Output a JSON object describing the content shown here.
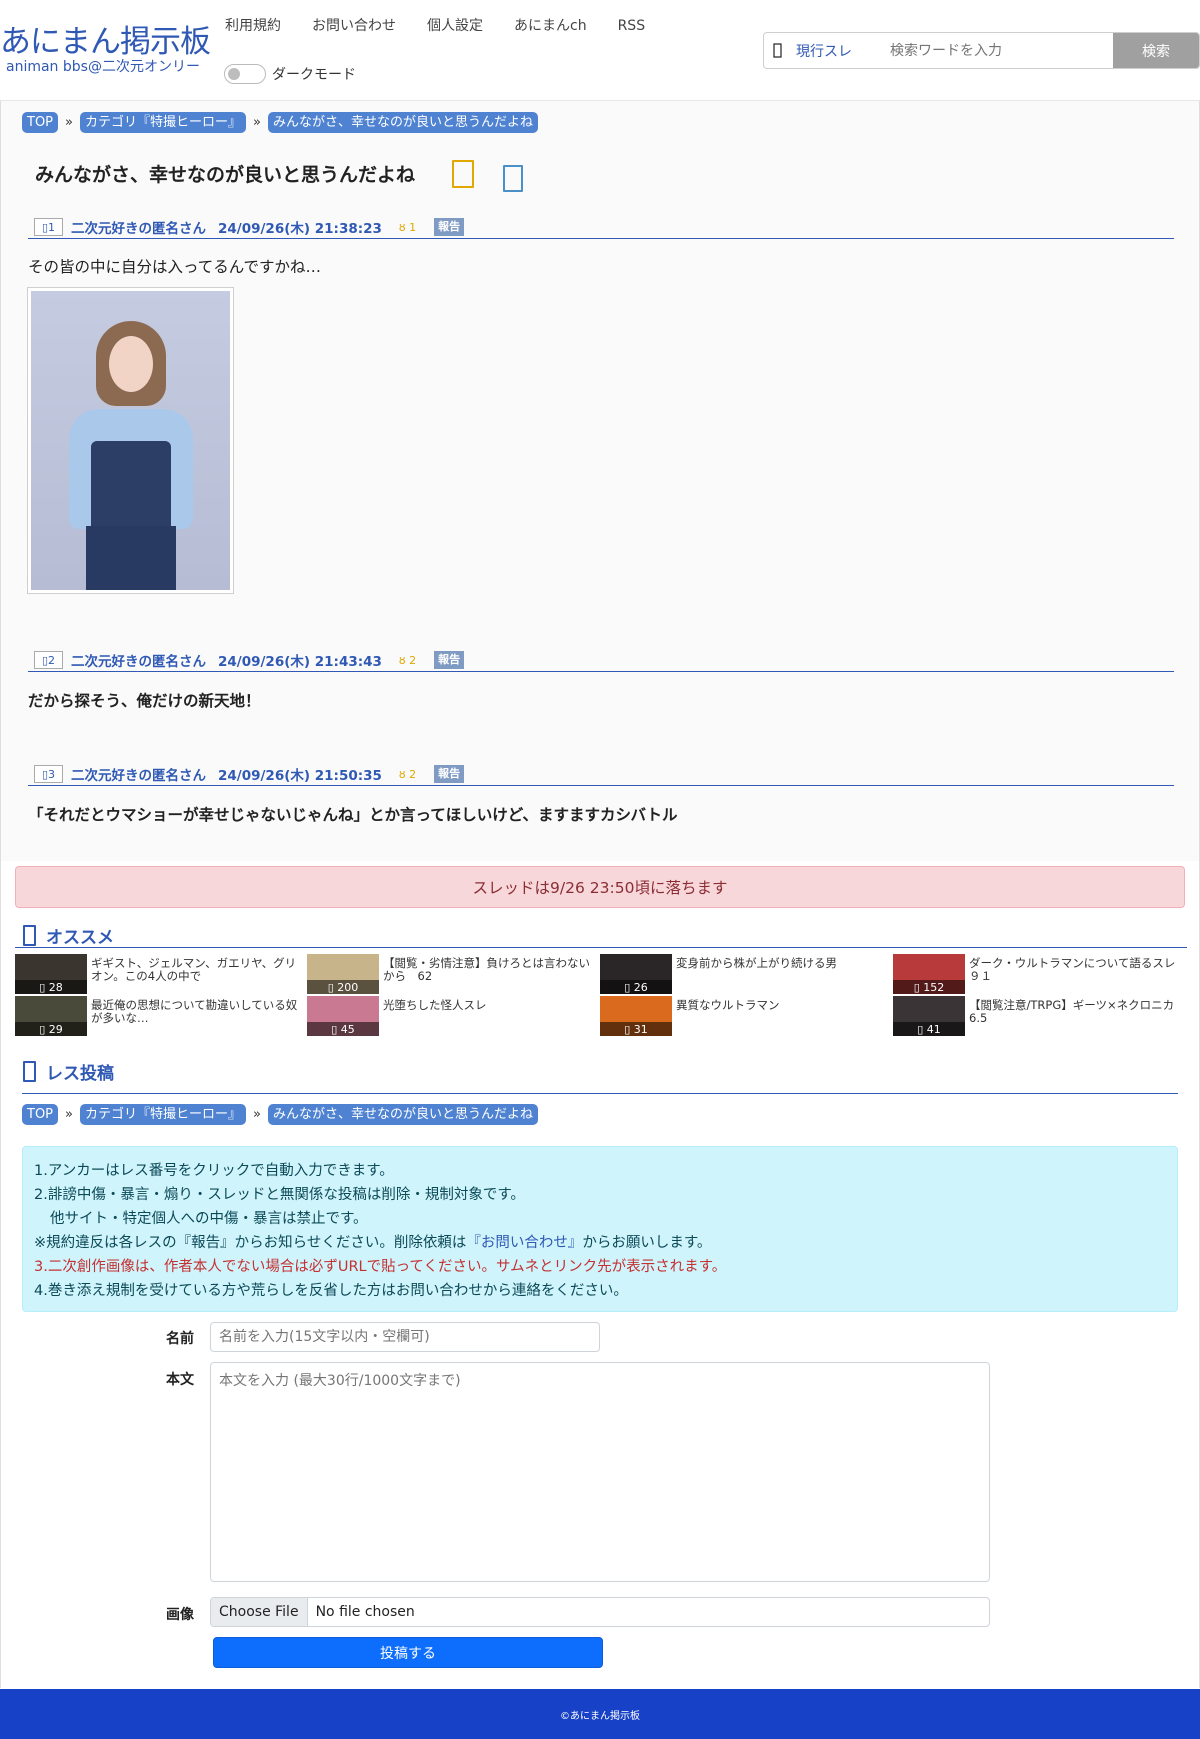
{
  "header": {
    "logo_main": "あにまん掲示板",
    "logo_sub": "animan bbs@二次元オンリー",
    "nav": [
      "利用規約",
      "お問い合わせ",
      "個人設定",
      "あにまんch",
      "RSS"
    ],
    "dark_mode_label": "ダークモード",
    "search": {
      "scope": "現行スレ",
      "placeholder": "検索ワードを入力",
      "button": "検索"
    }
  },
  "breadcrumb": {
    "top": "TOP",
    "category": "カテゴリ『特撮ヒーロー』",
    "thread": "みんながさ、幸せなのが良いと思うんだよね",
    "sep": "»"
  },
  "thread": {
    "title": "みんながさ、幸せなのが良いと思うんだよね",
    "posts": [
      {
        "num": "1",
        "name": "二次元好きの匿名さん",
        "date": "24/09/26(木) 21:38:23",
        "good": "1",
        "report": "報告",
        "body": "その皆の中に自分は入ってるんですかね…"
      },
      {
        "num": "2",
        "name": "二次元好きの匿名さん",
        "date": "24/09/26(木) 21:43:43",
        "good": "2",
        "report": "報告",
        "body": "だから探そう、俺だけの新天地！"
      },
      {
        "num": "3",
        "name": "二次元好きの匿名さん",
        "date": "24/09/26(木) 21:50:35",
        "good": "2",
        "report": "報告",
        "body": "「それだとウマショーが幸せじゃないじゃんね」とか言ってほしいけど、ますますカシバトル"
      }
    ]
  },
  "notice": "スレッドは9/26 23:50頃に落ちます",
  "recommend": {
    "title": "オススメ",
    "items": [
      {
        "count": "28",
        "text": "ギギスト、ジェルマン、ガエリヤ、グリオン。この4人の中で",
        "color": "#3b3530"
      },
      {
        "count": "200",
        "text": "【閲覧・劣情注意】負けろとは言わないから　62",
        "color": "#c8b48a"
      },
      {
        "count": "26",
        "text": "変身前から株が上がり続ける男",
        "color": "#2a2628"
      },
      {
        "count": "152",
        "text": "ダーク・ウルトラマンについて語るスレ　９１",
        "color": "#b83a3a"
      },
      {
        "count": "29",
        "text": "最近俺の思想について勘違いしている奴が多いな…",
        "color": "#4a4a3a"
      },
      {
        "count": "45",
        "text": "光堕ちした怪人スレ",
        "color": "#c97a92"
      },
      {
        "count": "31",
        "text": "異質なウルトラマン",
        "color": "#d96a1e"
      },
      {
        "count": "41",
        "text": "【閲覧注意/TRPG】ギーツ×ネクロニカ6.5",
        "color": "#3a3436"
      }
    ]
  },
  "reply": {
    "title": "レス投稿",
    "rules": {
      "r1": "1.アンカーはレス番号をクリックで自動入力できます。",
      "r2": "2.誹謗中傷・暴言・煽り・スレッドと無関係な投稿は削除・規制対象です。",
      "r2b": "他サイト・特定個人への中傷・暴言は禁止です。",
      "r_note_a": "※規約違反は各レスの『報告』からお知らせください。削除依頼は",
      "r_note_link": "『お問い合わせ』",
      "r_note_b": "からお願いします。",
      "r3": "3.二次創作画像は、作者本人でない場合は必ずURLで貼ってください。サムネとリンク先が表示されます。",
      "r4": "4.巻き添え規制を受けている方や荒らしを反省した方はお問い合わせから連絡をください。"
    },
    "name_label": "名前",
    "name_placeholder": "名前を入力(15文字以内・空欄可)",
    "body_label": "本文",
    "body_placeholder": "本文を入力 (最大30行/1000文字まで)",
    "image_label": "画像",
    "file_button": "Choose File",
    "file_status": "No file chosen",
    "submit": "投稿する"
  },
  "footer": "©あにまん掲示板",
  "colors": {
    "brand": "#2f59b4",
    "crumb": "#4f83d2",
    "notice_bg": "#f8d7da",
    "info_bg": "#cff4fc",
    "submit": "#0d6efd",
    "footer": "#1741c6"
  }
}
